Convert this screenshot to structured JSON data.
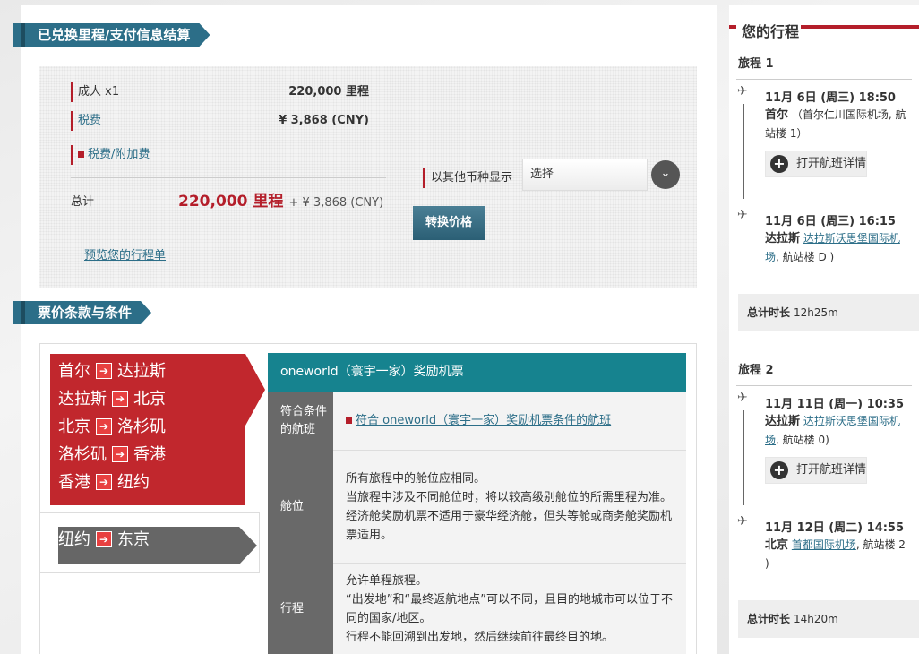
{
  "payment": {
    "title": "已兑换里程/支付信息结算",
    "adult_label": "成人 x1",
    "adult_value": "220,000 里程",
    "tax_label": "税费",
    "tax_value": "¥ 3,868 (CNY)",
    "surcharge_link": "税费/附加费",
    "total_label": "总计",
    "total_miles": "220,000 里程",
    "total_cash": "+ ¥ 3,868 (CNY)",
    "preview_link": "预览您的行程单",
    "currency_label": "以其他币种显示",
    "currency_select": "选择",
    "convert_button": "转换价格"
  },
  "fare": {
    "title": "票价条款与条件",
    "routes": [
      {
        "from": "首尔",
        "to": "达拉斯"
      },
      {
        "from": "达拉斯",
        "to": "北京"
      },
      {
        "from": "北京",
        "to": "洛杉矶"
      },
      {
        "from": "洛杉矶",
        "to": "香港"
      },
      {
        "from": "香港",
        "to": "纽约"
      }
    ],
    "route_other": {
      "from": "纽约",
      "to": "东京"
    },
    "arrow_glyph": "➔",
    "ticket_title": "oneworld（寰宇一家）奖励机票",
    "conditions": [
      {
        "label": "符合条件的航班",
        "lines": [
          "符合 oneworld（寰宇一家）奖励机票条件的航班"
        ]
      },
      {
        "label": "舱位",
        "lines": [
          "所有旅程中的舱位应相同。",
          "当旅程中涉及不同舱位时，将以较高级别舱位的所需里程为准。",
          "经济舱奖励机票不适用于豪华经济舱，但头等舱或商务舱奖励机票适用。"
        ]
      },
      {
        "label": "行程",
        "lines": [
          "允许单程旅程。",
          "“出发地”和“最终返航地点”可以不同，且目的地城市可以位于不同的国家/地区。",
          "行程不能回溯到出发地，然后继续前往最终目的地。"
        ]
      }
    ]
  },
  "itinerary": {
    "title": "您的行程",
    "detail_button": "打开航班详情",
    "total_label": "总计时长",
    "trips": [
      {
        "label": "旅程 1",
        "depart_time": "11月 6日 (周三)   18:50",
        "depart_city": "首尔",
        "depart_airport": "（首尔仁川国际机场, 航站楼  1）",
        "arrive_time": "11月 6日 (周三)   16:15",
        "arrive_city": "达拉斯",
        "arrive_airport_link": "达拉斯沃思堡国际机场",
        "arrive_terminal": ", 航站楼    D )",
        "duration": "12h25m"
      },
      {
        "label": "旅程 2",
        "depart_time": "11月 11日 (周一)   10:35",
        "depart_city": "达拉斯",
        "depart_airport_link": "达拉斯沃思堡国际机场",
        "depart_terminal": ", 航站楼  0)",
        "arrive_time": "11月 12日 (周二)   14:55",
        "arrive_city": "北京",
        "arrive_airport_link": "首都国际机场",
        "arrive_terminal": ", 航站楼  2 )",
        "duration": "14h20m"
      }
    ]
  }
}
